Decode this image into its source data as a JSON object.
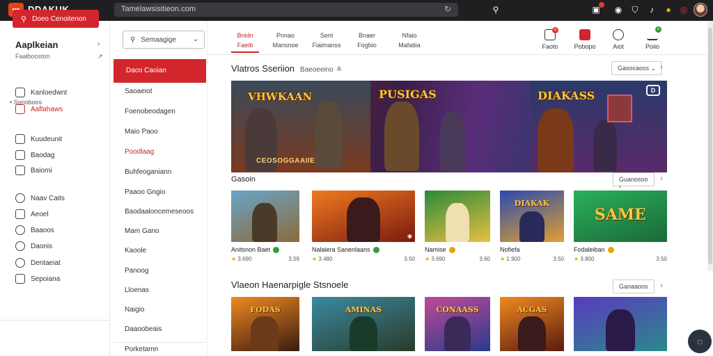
{
  "app": {
    "logo_letter": "m",
    "name": "DDAKUK",
    "url": "Tamelawsisitieon.com"
  },
  "sidebar": {
    "create_button": "Doeo Cenoitenon",
    "title": "Aaplkeian",
    "subtitle": "Faalbooston",
    "items_top": [
      {
        "label": "Kanloedwnt",
        "icon": "document-icon"
      },
      {
        "label": "Aaflahaws",
        "icon": "calendar-icon",
        "active": true
      }
    ],
    "section_label": "Sonoboos",
    "items_mid": [
      {
        "label": "Kuudeunit",
        "icon": "box-icon"
      },
      {
        "label": "Baodag",
        "icon": "cart-icon"
      },
      {
        "label": "Baiomi",
        "icon": "bag-icon"
      }
    ],
    "items_bottom": [
      {
        "label": "Naav Caits",
        "icon": "pin-icon"
      },
      {
        "label": "Aeoel",
        "icon": "gift-icon"
      },
      {
        "label": "Baaoos",
        "icon": "tag-icon"
      },
      {
        "label": "Daonis",
        "icon": "settings-icon"
      },
      {
        "label": "Dentaeiat",
        "icon": "clock-icon"
      },
      {
        "label": "Sepoiana",
        "icon": "bookmark-icon"
      }
    ]
  },
  "categories": {
    "select_label": "Semaagige",
    "items": [
      "Daco Caoian",
      "Saoaeiot",
      "Foenobeodagen",
      "Maio Paoo",
      "Poodlaag",
      "Buhfeoganiann",
      "Paaoo Gngio",
      "Baodaaloncemeseoos",
      "Mam Gano",
      "Kaoole",
      "Panoog",
      "Lloenas",
      "Naigio",
      "Daaoobeais",
      "Porketamn"
    ]
  },
  "tabs": [
    {
      "top": "Bnidn",
      "bottom": "Faeib",
      "active": true
    },
    {
      "top": "Pnnao",
      "bottom": "Mansnoe"
    },
    {
      "top": "Sent",
      "bottom": "Fiaimanss"
    },
    {
      "top": "Bnaer",
      "bottom": "Fogbio"
    },
    {
      "top": "Nfaio",
      "bottom": "Mafatiia"
    }
  ],
  "actions": [
    {
      "label": "Faoto",
      "icon": "screen-icon",
      "badge": "o"
    },
    {
      "label": "Pobopo",
      "icon": "video-icon"
    },
    {
      "label": "Aiot",
      "icon": "compass-icon"
    },
    {
      "label": "Poiio",
      "icon": "cart-icon",
      "badge": "o"
    }
  ],
  "featured": {
    "title": "Vlatros Sseriion",
    "subtitle": "Baeoeeino",
    "sort_label": "Gasocaoss",
    "hero": {
      "title_left": "VHWKAAN",
      "title_mid": "PUSIGAS",
      "title_right": "DIAKASS",
      "caption": "CEOSOGGAAIIE",
      "badge": "D"
    }
  },
  "section2": {
    "title": "Gasoin",
    "sort_label": "Guanosoo",
    "games": [
      {
        "title": "Anitsnon Baet",
        "rating": "3.690",
        "price": "3.59",
        "thumb_label": "",
        "colors": [
          "#6aa4c8",
          "#8b6a3a"
        ]
      },
      {
        "title": "Nalaiera Sanenlaans",
        "rating": "3.480",
        "price": "3.50",
        "thumb_label": "",
        "colors": [
          "#f07a20",
          "#7a1a10"
        ]
      },
      {
        "title": "Namise",
        "rating": "3.690",
        "price": "3.60",
        "thumb_label": "",
        "colors": [
          "#2a8a3a",
          "#e8c040"
        ]
      },
      {
        "title": "Nofiefa",
        "rating": "1.900",
        "price": "3.50",
        "thumb_label": "DIAKAK",
        "colors": [
          "#2a4ab0",
          "#e0a030"
        ]
      },
      {
        "title": "Fodaleiban",
        "rating": "3.800",
        "price": "3.50",
        "thumb_label": "SAME",
        "colors": [
          "#2ab05a",
          "#f0c040"
        ]
      }
    ]
  },
  "section3": {
    "title": "Vlaeon Haenarpigle Stsnoele",
    "sort_label": "Ganaaoos",
    "games": [
      {
        "thumb_label": "FODAS",
        "colors": [
          "#f08a20",
          "#3a1a10"
        ]
      },
      {
        "thumb_label": "AMINAS",
        "colors": [
          "#3a8aa0",
          "#2a3a2a"
        ]
      },
      {
        "thumb_label": "CONAASS",
        "colors": [
          "#c04a9a",
          "#2a3a8a"
        ]
      },
      {
        "thumb_label": "ACGAS",
        "colors": [
          "#f08a20",
          "#5a1a10"
        ]
      },
      {
        "thumb_label": "",
        "colors": [
          "#5a3ac0",
          "#2a8a8a"
        ]
      }
    ]
  }
}
